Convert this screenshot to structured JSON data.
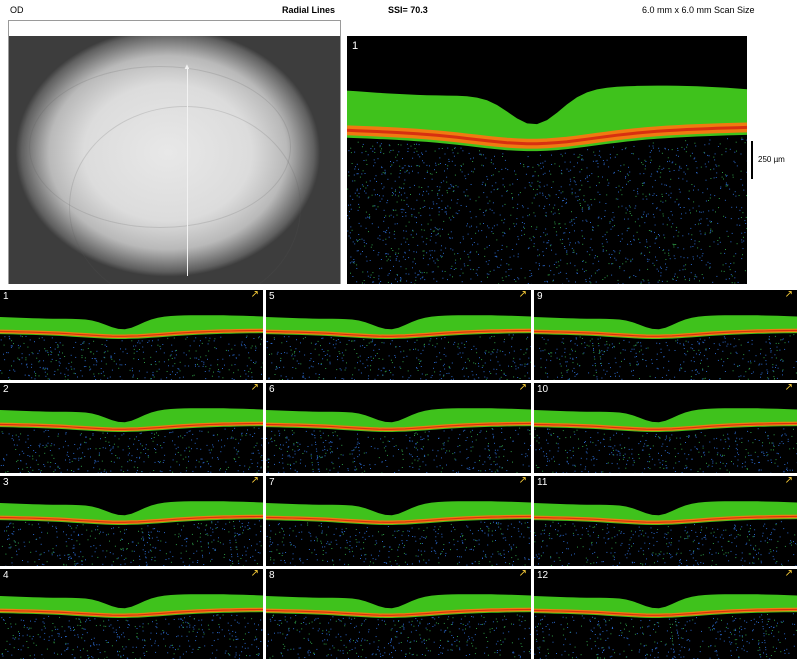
{
  "header": {
    "eye": "OD",
    "scan_pattern": "Radial Lines",
    "ssi": "SSI= 70.3",
    "scan_size": "6.0 mm x 6.0 mm Scan Size"
  },
  "main_scan": {
    "number": "1",
    "scale_label": "250 µm"
  },
  "thumbnails": [
    {
      "number": "1"
    },
    {
      "number": "2"
    },
    {
      "number": "3"
    },
    {
      "number": "4"
    },
    {
      "number": "5"
    },
    {
      "number": "6"
    },
    {
      "number": "7"
    },
    {
      "number": "8"
    },
    {
      "number": "9"
    },
    {
      "number": "10"
    },
    {
      "number": "11"
    },
    {
      "number": "12"
    }
  ],
  "colors": {
    "background": "#000000",
    "retina_green": "#3fc21c",
    "rpe_orange": "#f07a10",
    "rpe_red": "#d83010",
    "noise_blue": "#2a66c8",
    "arrow_yellow": "#ffd23a"
  },
  "icons": {
    "scan_direction": "arrow-icon",
    "scan_line": "scan-line-icon"
  }
}
